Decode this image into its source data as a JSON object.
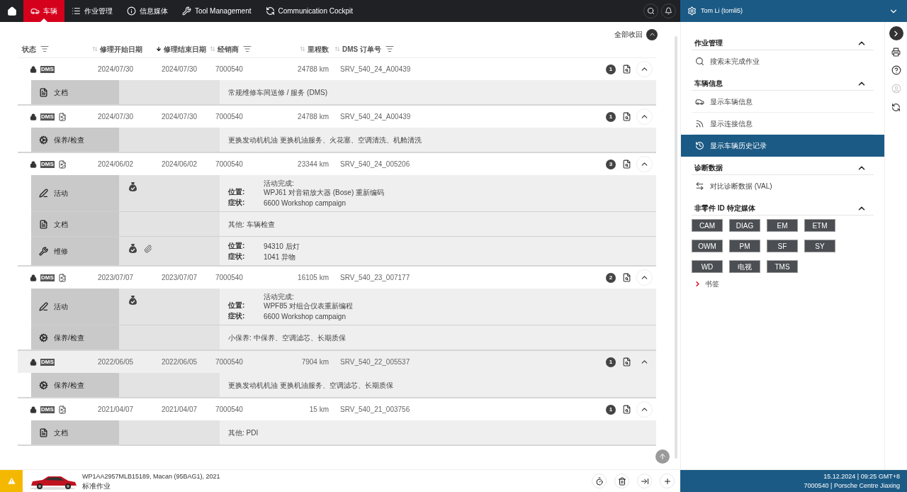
{
  "nav": {
    "tabs": [
      {
        "label": "车辆",
        "selected": true
      },
      {
        "label": "作业管理",
        "selected": false
      },
      {
        "label": "信息媒体",
        "selected": false
      },
      {
        "label": "Tool Management",
        "selected": false
      },
      {
        "label": "Communication Cockpit",
        "selected": false
      }
    ]
  },
  "user": {
    "name": "Tom Li (tomli5)"
  },
  "collapse_all": "全部收回",
  "columns": [
    {
      "label": "状态",
      "sortable": false,
      "filter": true
    },
    {
      "label": "修理开始日期",
      "sortable": true,
      "sorted": false,
      "filter": false
    },
    {
      "label": "修理结束日期",
      "sortable": true,
      "sorted": true,
      "filter": false
    },
    {
      "label": "经销商",
      "sortable": true,
      "sorted": false,
      "filter": true
    },
    {
      "label": "里程数",
      "sortable": true,
      "sorted": false,
      "filter": false
    },
    {
      "label": "DMS 订单号",
      "sortable": true,
      "sorted": false,
      "filter": true
    }
  ],
  "records": [
    {
      "badge": "DMS",
      "p_doc": false,
      "highlighted": false,
      "start": "2024/07/30",
      "end": "2024/07/30",
      "dealer": "7000540",
      "mileage": "24788 km",
      "order": "SRV_540_24_A00439",
      "count": "1",
      "expanded": true,
      "details": [
        {
          "kind": "document",
          "label": "文档",
          "money_bag": false,
          "paperclip": false,
          "text": "常规维修车间送修 / 服务 (DMS)"
        }
      ]
    },
    {
      "badge": "DMS",
      "p_doc": true,
      "highlighted": false,
      "start": "2024/07/30",
      "end": "2024/07/30",
      "dealer": "7000540",
      "mileage": "24788 km",
      "order": "SRV_540_24_A00439",
      "count": "1",
      "expanded": true,
      "details": [
        {
          "kind": "maintenance",
          "label": "保养/检查",
          "money_bag": false,
          "paperclip": false,
          "text": "更换发动机机油 更换机油服务、火花塞、空调清洗、机舱清洗"
        }
      ]
    },
    {
      "badge": "DMS",
      "p_doc": true,
      "highlighted": false,
      "start": "2024/06/02",
      "end": "2024/06/02",
      "dealer": "7000540",
      "mileage": "23344 km",
      "order": "SRV_540_24_005206",
      "count": "3",
      "expanded": true,
      "details": [
        {
          "kind": "activity",
          "label": "活动",
          "money_bag": true,
          "paperclip": false,
          "fields": [
            {
              "label": "位置:",
              "lines": [
                "活动完成:",
                "WPJ61 对音箱放大器 (Bose) 重新编码"
              ]
            },
            {
              "label": "症状:",
              "lines": [
                "6600 Workshop campaign"
              ]
            }
          ]
        },
        {
          "kind": "document",
          "label": "文档",
          "money_bag": false,
          "paperclip": false,
          "text": "其他: 车辆检查"
        },
        {
          "kind": "repair",
          "label": "维修",
          "money_bag": true,
          "paperclip": true,
          "fields": [
            {
              "label": "位置:",
              "lines": [
                "94310 后灯"
              ]
            },
            {
              "label": "症状:",
              "lines": [
                "1041 异物"
              ]
            }
          ]
        }
      ]
    },
    {
      "badge": "DMS",
      "p_doc": true,
      "highlighted": false,
      "start": "2023/07/07",
      "end": "2023/07/07",
      "dealer": "7000540",
      "mileage": "16105 km",
      "order": "SRV_540_23_007177",
      "count": "2",
      "expanded": true,
      "details": [
        {
          "kind": "activity",
          "label": "活动",
          "money_bag": true,
          "paperclip": false,
          "fields": [
            {
              "label": "位置:",
              "lines": [
                "活动完成:",
                "WPF85 对组合仪表重新编程"
              ]
            },
            {
              "label": "症状:",
              "lines": [
                "6600 Workshop campaign"
              ]
            }
          ]
        },
        {
          "kind": "maintenance",
          "label": "保养/检查",
          "money_bag": false,
          "paperclip": false,
          "text": "小保养: 中保养、空调滤芯、长期质保"
        }
      ]
    },
    {
      "badge": "DMS",
      "p_doc": false,
      "highlighted": true,
      "start": "2022/06/05",
      "end": "2022/06/05",
      "dealer": "7000540",
      "mileage": "7904 km",
      "order": "SRV_540_22_005537",
      "count": "1",
      "expanded": true,
      "details": [
        {
          "kind": "maintenance",
          "label": "保养/检查",
          "money_bag": false,
          "paperclip": false,
          "text": "更换发动机机油 更换机油服务、空调滤芯、长期质保"
        }
      ]
    },
    {
      "badge": "DMS",
      "p_doc": true,
      "highlighted": false,
      "start": "2021/04/07",
      "end": "2021/04/07",
      "dealer": "7000540",
      "mileage": "15 km",
      "order": "SRV_540_21_003756",
      "count": "1",
      "expanded": true,
      "details": [
        {
          "kind": "document",
          "label": "文档",
          "money_bag": false,
          "paperclip": false,
          "text": "其他: PDI"
        }
      ]
    }
  ],
  "panel": {
    "sections": [
      {
        "title": "作业管理",
        "expanded": true,
        "items": [
          {
            "label": "搜索未完成作业",
            "selected": false
          }
        ]
      },
      {
        "title": "车辆信息",
        "expanded": true,
        "items": [
          {
            "label": "显示车辆信息",
            "selected": false
          },
          {
            "label": "显示连接信息",
            "selected": false
          },
          {
            "label": "显示车辆历史记录",
            "selected": true
          }
        ]
      },
      {
        "title": "诊断数据",
        "expanded": true,
        "items": [
          {
            "label": "对比诊断数据 (VAL)",
            "selected": false
          }
        ]
      },
      {
        "title": "非零件 ID 特定媒体",
        "expanded": true,
        "media": [
          "CAM",
          "DIAG",
          "EM",
          "ETM",
          "OWM",
          "PM",
          "SF",
          "SY",
          "WD",
          "电视",
          "TMS"
        ]
      }
    ],
    "bookmark": "书签"
  },
  "footer": {
    "vehicle": "WP1AA2957MLB15189, Macan (95BAG1), 2021",
    "job": "标准作业",
    "datetime": "15.12.2024 | 09:25 GMT+8",
    "dealer": "7000540 | Porsche Centre Jiaxing"
  }
}
